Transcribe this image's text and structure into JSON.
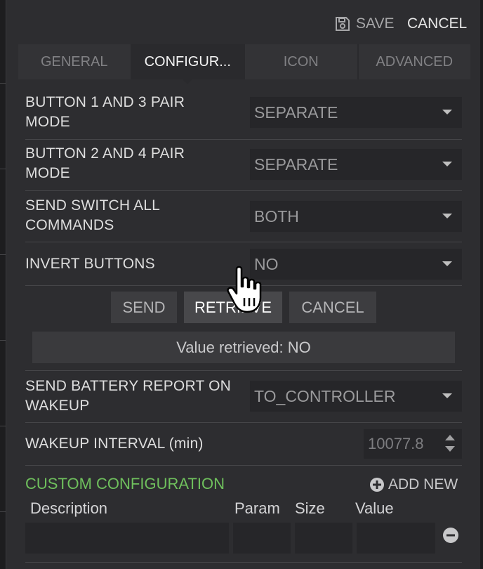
{
  "header": {
    "save_label": "SAVE",
    "cancel_label": "CANCEL"
  },
  "tabs": [
    {
      "label": "GENERAL",
      "active": false
    },
    {
      "label": "CONFIGUR...",
      "active": true
    },
    {
      "label": "ICON",
      "active": false
    },
    {
      "label": "ADVANCED",
      "active": false
    }
  ],
  "config": {
    "button13": {
      "label_line1": "BUTTON 1 AND 3 PAIR",
      "label_line2": "MODE",
      "value": "SEPARATE"
    },
    "button24": {
      "label_line1": "BUTTON 2 AND 4 PAIR",
      "label_line2": "MODE",
      "value": "SEPARATE"
    },
    "switch_all": {
      "label_line1": "SEND SWITCH ALL",
      "label_line2": "COMMANDS",
      "value": "BOTH"
    },
    "invert": {
      "label": "INVERT BUTTONS",
      "value": "NO"
    }
  },
  "actions": {
    "send_label": "SEND",
    "retrieve_label": "RETRIEVE",
    "cancel_label": "CANCEL"
  },
  "status": {
    "message": "Value retrieved: NO"
  },
  "battery": {
    "label_line1": "SEND BATTERY REPORT ON",
    "label_line2": "WAKEUP",
    "value": "TO_CONTROLLER"
  },
  "wakeup": {
    "label": "WAKEUP INTERVAL (min)",
    "value": "10077.8"
  },
  "custom": {
    "heading": "CUSTOM CONFIGURATION",
    "add_label": "ADD NEW",
    "columns": {
      "description": "Description",
      "param": "Param",
      "size": "Size",
      "value": "Value"
    }
  },
  "colors": {
    "accent_green": "#6fc05d",
    "panel_bg": "#2d2d30",
    "field_bg": "#262629"
  },
  "icons": {
    "save": "floppy-disk-icon",
    "add": "plus-circle-icon",
    "remove": "minus-circle-icon",
    "cursor": "hand-pointer-icon",
    "dropdown": "caret-down-icon"
  }
}
